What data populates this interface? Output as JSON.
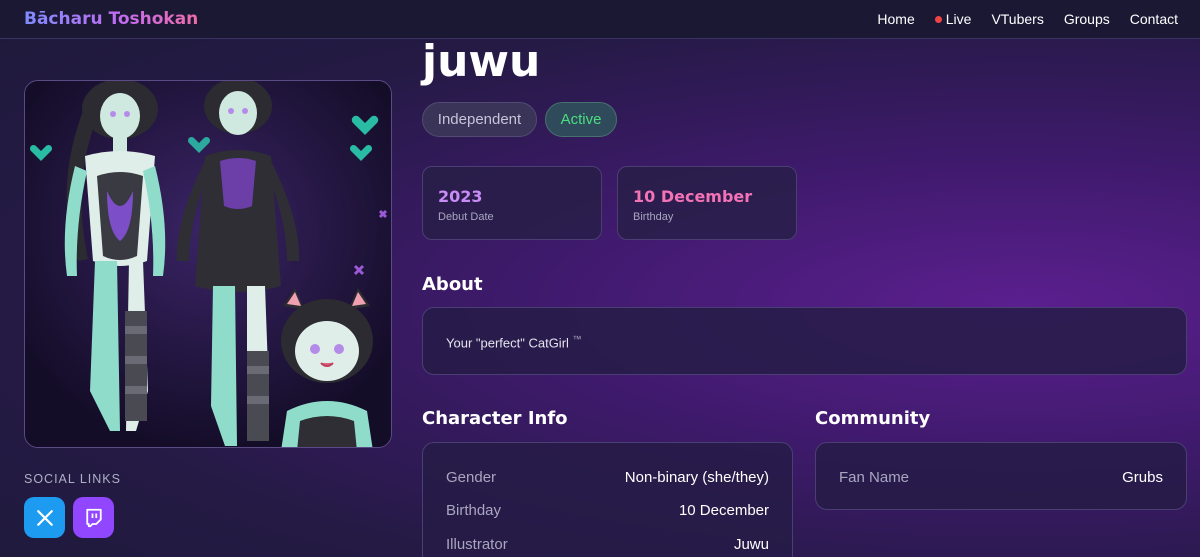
{
  "nav": {
    "brand": "Bācharu Toshokan",
    "links": [
      {
        "label": "Home"
      },
      {
        "label": "Live",
        "indicator_color": "#ef4444"
      },
      {
        "label": "VTubers"
      },
      {
        "label": "Groups"
      },
      {
        "label": "Contact"
      }
    ]
  },
  "profile": {
    "name": "juwu",
    "tags": [
      "Independent",
      "Active"
    ],
    "stats": [
      {
        "value": "2023",
        "label": "Debut Date",
        "color": "#c98cf6"
      },
      {
        "value": "10 December",
        "label": "Birthday",
        "color": "#f472b6"
      }
    ]
  },
  "social": {
    "label": "SOCIAL LINKS",
    "links": [
      {
        "icon": "x-logo-icon",
        "color": "#1d9bf0"
      },
      {
        "icon": "twitch-logo-icon",
        "color": "#9146ff"
      }
    ]
  },
  "about": {
    "title": "About",
    "text": "Your \"perfect\" CatGirl",
    "mark": "™"
  },
  "character_info": {
    "title": "Character Info",
    "rows": [
      {
        "key": "Gender",
        "value": "Non-binary (she/they)"
      },
      {
        "key": "Birthday",
        "value": "10 December"
      },
      {
        "key": "Illustrator",
        "value": "Juwu"
      }
    ]
  },
  "community": {
    "title": "Community",
    "rows": [
      {
        "key": "Fan Name",
        "value": "Grubs"
      }
    ]
  },
  "colors": {
    "accent_purple": "#c98cf6",
    "accent_pink": "#f472b6",
    "active_green": "#4ade80"
  }
}
